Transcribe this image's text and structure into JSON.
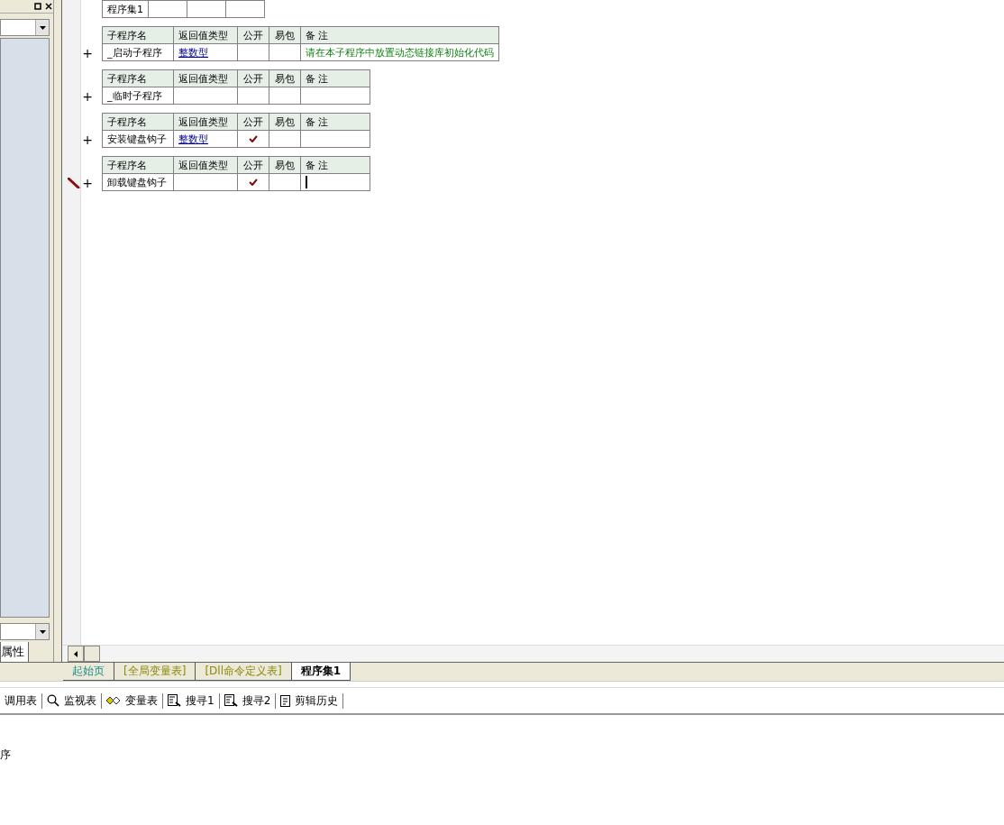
{
  "left_panel": {
    "tab": "属性"
  },
  "program_set": {
    "headers": [
      "程序集1"
    ]
  },
  "subroutines": [
    {
      "headers": [
        "子程序名",
        "返回值类型",
        "公开",
        "易包",
        "备 注"
      ],
      "name": "_启动子程序",
      "return_type": "整数型",
      "public": false,
      "note": "请在本子程序中放置动态链接库初始化代码",
      "current": false
    },
    {
      "headers": [
        "子程序名",
        "返回值类型",
        "公开",
        "易包",
        "备 注"
      ],
      "name": "_临时子程序",
      "public": false,
      "current": false
    },
    {
      "headers": [
        "子程序名",
        "返回值类型",
        "公开",
        "易包",
        "备 注"
      ],
      "name": "安装键盘钩子",
      "return_type": "整数型",
      "public": true,
      "current": false
    },
    {
      "headers": [
        "子程序名",
        "返回值类型",
        "公开",
        "易包",
        "备 注"
      ],
      "name": "卸载键盘钩子",
      "public": true,
      "current": true
    }
  ],
  "expand_marker": "+",
  "editor_tabs": [
    {
      "label": "起始页",
      "kind": "page",
      "selected": false
    },
    {
      "label": "[全局变量表]",
      "kind": "table",
      "selected": false
    },
    {
      "label": "[Dll命令定义表]",
      "kind": "table",
      "selected": false
    },
    {
      "label": "程序集1",
      "kind": "code",
      "selected": true
    }
  ],
  "toolbar": [
    {
      "label": "调用表",
      "kind": "none"
    },
    {
      "label": "监视表",
      "kind": "magnifier"
    },
    {
      "label": "变量表",
      "kind": "diamond"
    },
    {
      "label": "搜寻1",
      "kind": "search"
    },
    {
      "label": "搜寻2",
      "kind": "search"
    },
    {
      "label": "剪辑历史",
      "kind": "clipboard"
    }
  ],
  "output": {
    "text": "序"
  }
}
